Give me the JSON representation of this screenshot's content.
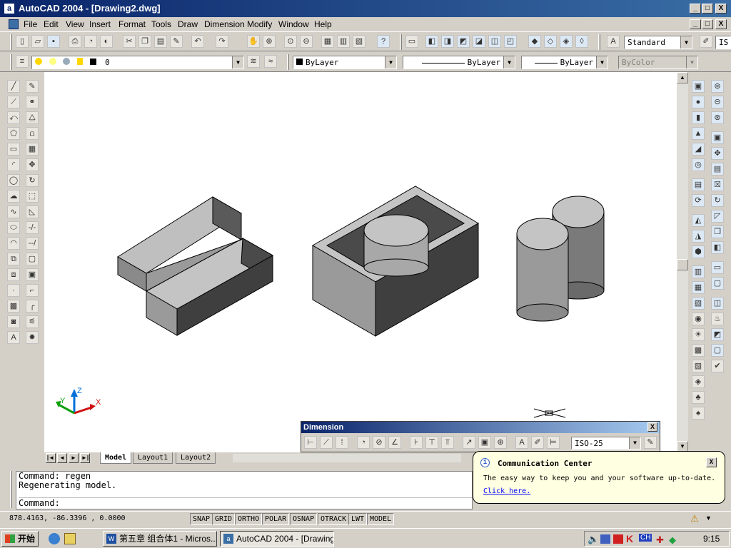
{
  "window": {
    "title": "AutoCAD 2004 - [Drawing2.dwg]",
    "app_icon": "a",
    "buttons": [
      "_",
      "□",
      "X"
    ],
    "doc_buttons": [
      "_",
      "□",
      "X"
    ]
  },
  "menu": [
    "File",
    "Edit",
    "View",
    "Insert",
    "Format",
    "Tools",
    "Draw",
    "Dimension",
    "Modify",
    "Window",
    "Help"
  ],
  "toolbar": {
    "text_style": "Standard",
    "text_style_trunc": "IS"
  },
  "properties_bar": {
    "layer": "0",
    "color": "ByLayer",
    "linetype": "ByLayer",
    "lineweight": "ByLayer",
    "plotstyle": "ByColor"
  },
  "ucs": {
    "x": "X",
    "y": "Y",
    "z": "Z"
  },
  "tabs": [
    "Model",
    "Layout1",
    "Layout2"
  ],
  "tab_nav": [
    "|◄",
    "◄",
    "►",
    "►|"
  ],
  "command": {
    "lines": [
      "Command: regen",
      "Regenerating model."
    ],
    "prompt": "Command:"
  },
  "status": {
    "coords": "878.4163,  -86.3396 , 0.0000",
    "toggles": [
      "SNAP",
      "GRID",
      "ORTHO",
      "POLAR",
      "OSNAP",
      "OTRACK",
      "LWT",
      "MODEL"
    ]
  },
  "dimension_toolbar": {
    "title": "Dimension",
    "close": "X",
    "dimstyle": "ISO-25"
  },
  "balloon": {
    "title": "Communication Center",
    "body": "The easy way to keep you and your software up-to-date.",
    "link": "Click here.",
    "close": "X"
  },
  "taskbar": {
    "start": "开始",
    "tasks": [
      "第五章 组合体1 - Micros...",
      "AutoCAD 2004 - [Drawing..."
    ],
    "clock": "9:15",
    "tray": [
      "K",
      "CH"
    ]
  },
  "colors": {
    "title_gradient_start": "#0a246a",
    "title_gradient_end": "#3a6ea5",
    "face": "#d4d0c8",
    "balloon": "#ffffe1"
  }
}
